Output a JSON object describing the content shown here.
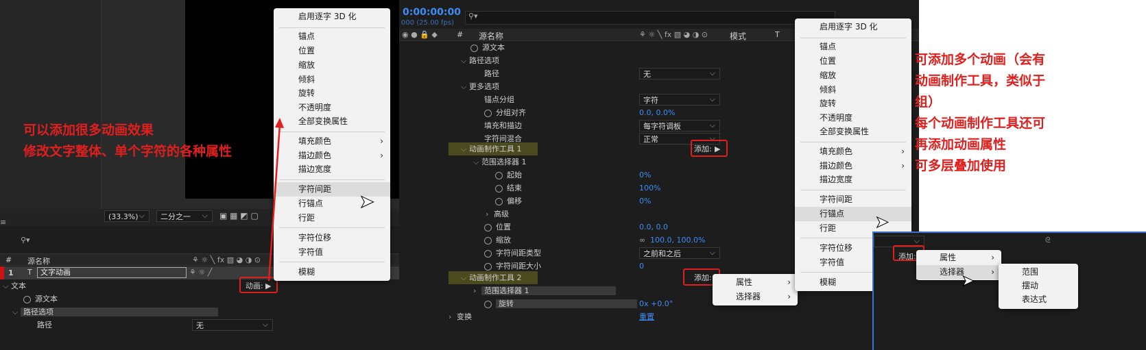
{
  "left": {
    "zoom": "(33.3%)",
    "resolution": "二分之一",
    "header": {
      "num": "#",
      "name": "源名称"
    },
    "layer": {
      "num": "1",
      "type": "T",
      "name": "文字动画"
    },
    "animate_label": "动画:",
    "rows": [
      "文本",
      "源文本",
      "路径选项",
      "路径"
    ],
    "path_value": "无",
    "menu_items": [
      "启用逐字 3D 化",
      "锚点",
      "位置",
      "缩放",
      "倾斜",
      "旋转",
      "不透明度",
      "全部变换属性",
      "填充颜色",
      "描边颜色",
      "描边宽度",
      "字符间距",
      "行锚点",
      "行距",
      "字符位移",
      "字符值",
      "模糊"
    ]
  },
  "annotation_left": [
    "可以添加很多动画效果",
    "修改文字整体、单个字符的各种属性"
  ],
  "mid": {
    "timecode": "0:00:00:00",
    "fps": "000 (25.00 fps)",
    "header": {
      "num": "#",
      "name": "源名称",
      "mode": "模式",
      "t": "T"
    },
    "rows": [
      {
        "label": "源文本"
      },
      {
        "label": "路径选项"
      },
      {
        "label": "路径",
        "value": "无"
      },
      {
        "label": "更多选项"
      },
      {
        "label": "锚点分组",
        "value": "字符"
      },
      {
        "label": "分组对齐",
        "value": "0.0, 0.0%"
      },
      {
        "label": "填充和描边",
        "value": "每字符调板"
      },
      {
        "label": "字符间混合",
        "value": "正常"
      },
      {
        "label": "动画制作工具 1",
        "value": "添加:"
      },
      {
        "label": "范围选择器 1"
      },
      {
        "label": "起始",
        "value": "0%"
      },
      {
        "label": "结束",
        "value": "100%"
      },
      {
        "label": "偏移",
        "value": "0%"
      },
      {
        "label": "高级"
      },
      {
        "label": "位置",
        "value": "0.0, 0.0"
      },
      {
        "label": "缩放",
        "value": "100.0, 100.0%"
      },
      {
        "label": "字符间距类型",
        "value": "之前和之后"
      },
      {
        "label": "字符间距大小",
        "value": "0"
      },
      {
        "label": "动画制作工具 2",
        "value": "添加:"
      },
      {
        "label": "范围选择器 1"
      },
      {
        "label": "旋转",
        "value": "0x +0.0°"
      },
      {
        "label": "变换",
        "value": "重置"
      }
    ],
    "submenu": [
      "属性",
      "选择器"
    ]
  },
  "right_menu": [
    "启用逐字 3D 化",
    "锚点",
    "位置",
    "缩放",
    "倾斜",
    "旋转",
    "不透明度",
    "全部变换属性",
    "填充颜色",
    "描边颜色",
    "描边宽度",
    "字符间距",
    "行锚点",
    "行距",
    "字符位移",
    "字符值",
    "模糊"
  ],
  "annotation_right": [
    "可添加多个动画（会有",
    "动画制作工具，类似于",
    "组）",
    "每个动画制作工具还可",
    "再添加动画属性",
    "可多层叠加使用"
  ],
  "bottom_right": {
    "add_label": "添加:",
    "menu": [
      "属性",
      "选择器"
    ],
    "selector_submenu": [
      "范围",
      "摆动",
      "表达式"
    ]
  }
}
